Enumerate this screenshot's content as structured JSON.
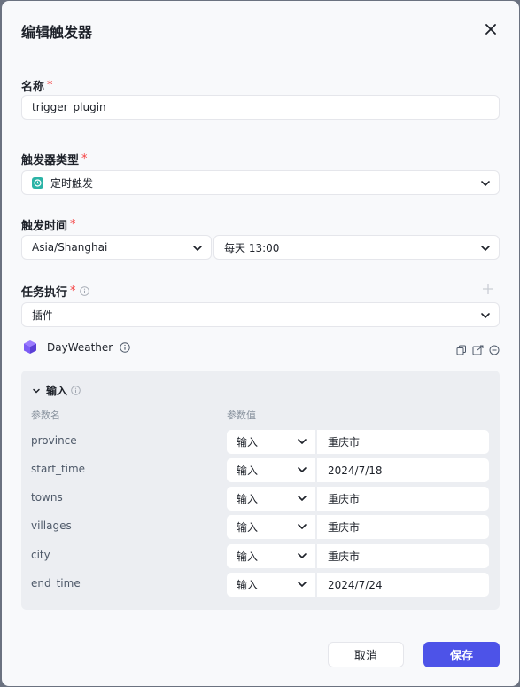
{
  "dialog": {
    "title": "编辑触发器",
    "name_label": "名称",
    "name_value": "trigger_plugin",
    "trigger_type_label": "触发器类型",
    "trigger_type_value": "定时触发",
    "trigger_time_label": "触发时间",
    "timezone_value": "Asia/Shanghai",
    "schedule_value": "每天 13:00",
    "task_label": "任务执行",
    "task_value": "插件",
    "plugin_name": "DayWeather",
    "required_mark": "*"
  },
  "input_panel": {
    "title": "输入",
    "col_name": "参数名",
    "col_value": "参数值",
    "rows": [
      {
        "name": "province",
        "type": "输入",
        "value": "重庆市"
      },
      {
        "name": "start_time",
        "type": "输入",
        "value": "2024/7/18"
      },
      {
        "name": "towns",
        "type": "输入",
        "value": "重庆市"
      },
      {
        "name": "villages",
        "type": "输入",
        "value": "重庆市"
      },
      {
        "name": "city",
        "type": "输入",
        "value": "重庆市"
      },
      {
        "name": "end_time",
        "type": "输入",
        "value": "2024/7/24"
      }
    ]
  },
  "footer": {
    "cancel_label": "取消",
    "save_label": "保存"
  },
  "colors": {
    "accent": "#4d53e8",
    "required": "#f53f3f",
    "timer_icon": "#2bb3a6",
    "plugin_icon": "#7c5cf5"
  }
}
